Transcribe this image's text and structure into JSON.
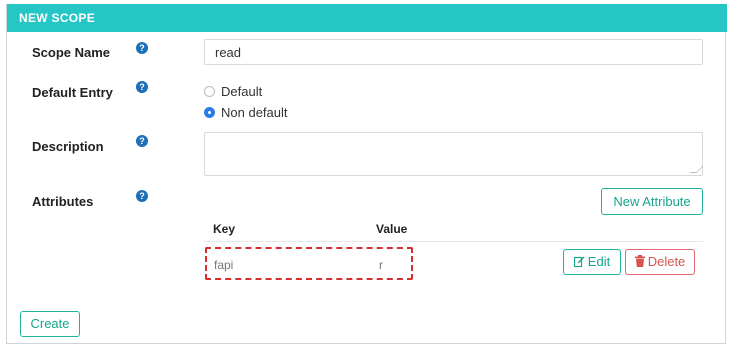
{
  "header": {
    "title": "NEW SCOPE"
  },
  "form": {
    "scope_name_label": "Scope Name",
    "scope_name_value": "read",
    "default_entry_label": "Default Entry",
    "radio_default_label": "Default",
    "radio_non_default_label": "Non default",
    "selected_entry": "Non default",
    "description_label": "Description",
    "description_value": "",
    "attributes_label": "Attributes",
    "help_glyph": "?"
  },
  "attributes": {
    "new_attribute_label": "New Attribute",
    "columns": {
      "key": "Key",
      "value": "Value"
    },
    "rows": [
      {
        "key": "fapi",
        "value": "r",
        "edit_label": "Edit",
        "delete_label": "Delete"
      }
    ]
  },
  "actions": {
    "create_label": "Create"
  },
  "colors": {
    "header_bg": "#26c6c6",
    "teal_button": "#20b39b",
    "danger": "#d9534f",
    "help_icon": "#1e6fb5",
    "highlight_border": "#d32f2f"
  }
}
